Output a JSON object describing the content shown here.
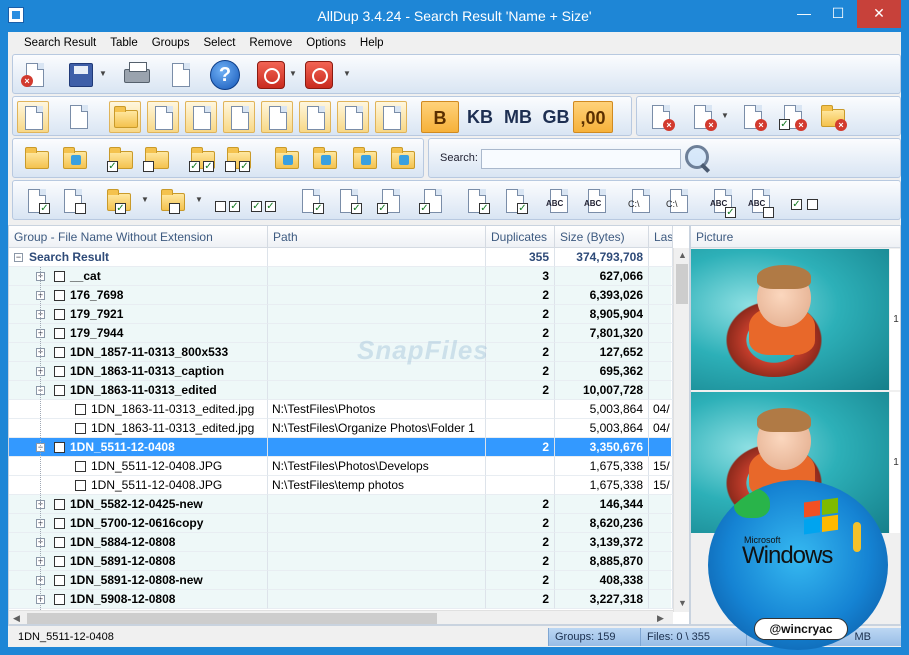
{
  "window": {
    "title": "AllDup 3.4.24 - Search Result 'Name + Size'",
    "controls": {
      "minimize": "—",
      "maximize": "☐",
      "close": "✕"
    }
  },
  "menu": [
    "Search Result",
    "Table",
    "Groups",
    "Select",
    "Remove",
    "Options",
    "Help"
  ],
  "toolbar": {
    "units": [
      "B",
      "KB",
      "MB",
      "GB",
      ",00"
    ],
    "selected_unit": ",00",
    "search_label": "Search:",
    "search_value": "",
    "abc_label": "ABC",
    "drive_label": "C:\\"
  },
  "grid": {
    "columns": [
      "Group - File Name Without Extension",
      "Path",
      "Duplicates",
      "Size (Bytes)",
      "Last"
    ],
    "root": {
      "name": "Search Result",
      "duplicates": "355",
      "size": "374,793,708"
    },
    "rows": [
      {
        "kind": "group",
        "name": "__cat",
        "path": "",
        "dup": "3",
        "size": "627,066",
        "last": "",
        "exp": "+"
      },
      {
        "kind": "group",
        "name": "176_7698",
        "path": "",
        "dup": "2",
        "size": "6,393,026",
        "last": "",
        "exp": "+"
      },
      {
        "kind": "group",
        "name": "179_7921",
        "path": "",
        "dup": "2",
        "size": "8,905,904",
        "last": "",
        "exp": "+"
      },
      {
        "kind": "group",
        "name": "179_7944",
        "path": "",
        "dup": "2",
        "size": "7,801,320",
        "last": "",
        "exp": "+"
      },
      {
        "kind": "group",
        "name": "1DN_1857-11-0313_800x533",
        "path": "",
        "dup": "2",
        "size": "127,652",
        "last": "",
        "exp": "+"
      },
      {
        "kind": "group",
        "name": "1DN_1863-11-0313_caption",
        "path": "",
        "dup": "2",
        "size": "695,362",
        "last": "",
        "exp": "+"
      },
      {
        "kind": "group",
        "name": "1DN_1863-11-0313_edited",
        "path": "",
        "dup": "2",
        "size": "10,007,728",
        "last": "",
        "exp": "−"
      },
      {
        "kind": "file",
        "name": "1DN_1863-11-0313_edited.jpg",
        "path": "N:\\TestFiles\\Photos",
        "dup": "",
        "size": "5,003,864",
        "last": "04/",
        "exp": ""
      },
      {
        "kind": "file",
        "name": "1DN_1863-11-0313_edited.jpg",
        "path": "N:\\TestFiles\\Organize Photos\\Folder 1",
        "dup": "",
        "size": "5,003,864",
        "last": "04/",
        "exp": ""
      },
      {
        "kind": "selected",
        "name": "1DN_5511-12-0408",
        "path": "",
        "dup": "2",
        "size": "3,350,676",
        "last": "",
        "exp": "−"
      },
      {
        "kind": "file",
        "name": "1DN_5511-12-0408.JPG",
        "path": "N:\\TestFiles\\Photos\\Develops",
        "dup": "",
        "size": "1,675,338",
        "last": "15/",
        "exp": ""
      },
      {
        "kind": "file",
        "name": "1DN_5511-12-0408.JPG",
        "path": "N:\\TestFiles\\temp photos",
        "dup": "",
        "size": "1,675,338",
        "last": "15/",
        "exp": ""
      },
      {
        "kind": "group",
        "name": "1DN_5582-12-0425-new",
        "path": "",
        "dup": "2",
        "size": "146,344",
        "last": "",
        "exp": "+"
      },
      {
        "kind": "group",
        "name": "1DN_5700-12-0616copy",
        "path": "",
        "dup": "2",
        "size": "8,620,236",
        "last": "",
        "exp": "+"
      },
      {
        "kind": "group",
        "name": "1DN_5884-12-0808",
        "path": "",
        "dup": "2",
        "size": "3,139,372",
        "last": "",
        "exp": "+"
      },
      {
        "kind": "group",
        "name": "1DN_5891-12-0808",
        "path": "",
        "dup": "2",
        "size": "8,885,870",
        "last": "",
        "exp": "+"
      },
      {
        "kind": "group",
        "name": "1DN_5891-12-0808-new",
        "path": "",
        "dup": "2",
        "size": "408,338",
        "last": "",
        "exp": "+"
      },
      {
        "kind": "group",
        "name": "1DN_5908-12-0808",
        "path": "",
        "dup": "2",
        "size": "3,227,318",
        "last": "",
        "exp": "+"
      }
    ]
  },
  "picture": {
    "header": "Picture",
    "edge_label": "1"
  },
  "status": {
    "current": "1DN_5511-12-0408",
    "groups": "Groups: 159",
    "files": "Files: 0 \\ 355",
    "size_unit": "MB"
  },
  "watermark": "SnapFiles",
  "overlay": {
    "microsoft": "Microsoft",
    "windows": "Windows",
    "handle": "@wincryac"
  },
  "colors": {
    "accent": "#1e86d6",
    "selection": "#3399ff",
    "group_row": "#eef8f8",
    "close": "#c7413a"
  }
}
